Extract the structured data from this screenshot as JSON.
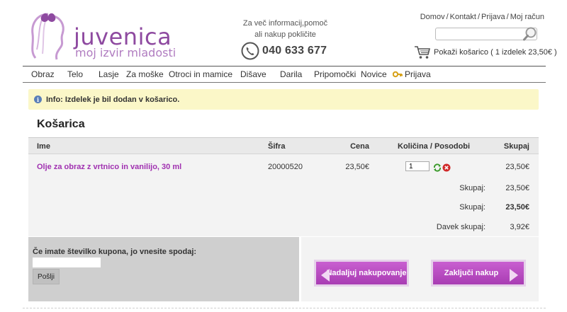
{
  "header": {
    "logo": {
      "name": "juvenica",
      "tagline": "moj izvir mladosti"
    },
    "contact": {
      "line1": "Za več informacij,pomoč",
      "line2": "ali nakup pokličite",
      "phone": "040 633 677"
    },
    "top_links": [
      "Domov",
      "Kontakt",
      "Prijava",
      "Moj račun"
    ],
    "search": {
      "value": "",
      "placeholder": ""
    },
    "cart": {
      "label": "Pokaži košarico",
      "summary": "( 1 izdelek 23,50€ )"
    }
  },
  "nav": {
    "items": [
      "Obraz",
      "Telo",
      "Lasje",
      "Za moške",
      "Otroci in mamice",
      "Dišave",
      "Darila",
      "Pripomočki",
      "Novice",
      "Prijava"
    ]
  },
  "info": {
    "text": "Info: Izdelek je bil dodan v košarico."
  },
  "cart_page": {
    "title": "Košarica",
    "columns": [
      "Ime",
      "Šifra",
      "Cena",
      "Količina / Posodobi",
      "Skupaj"
    ],
    "rows": [
      {
        "name": "Olje za obraz z vrtnico in vanilijo, 30 ml",
        "sku": "20000520",
        "price": "23,50€",
        "qty": "1",
        "total": "23,50€"
      }
    ],
    "subtotal_label": "Skupaj:",
    "subtotal": "23,50€",
    "total_label": "Skupaj:",
    "total": "23,50€",
    "tax_label": "Davek skupaj:",
    "tax": "3,92€"
  },
  "coupon": {
    "label": "Če imate številko kupona, jo vnesite spodaj:",
    "value": "",
    "button": "Pošlji"
  },
  "actions": {
    "continue": "Nadaljuj nakupovanje",
    "checkout": "Zaključi nakup"
  },
  "colors": {
    "brand": "#a83cb3",
    "info_bg": "#fbf7c8",
    "link": "#a030b0"
  }
}
